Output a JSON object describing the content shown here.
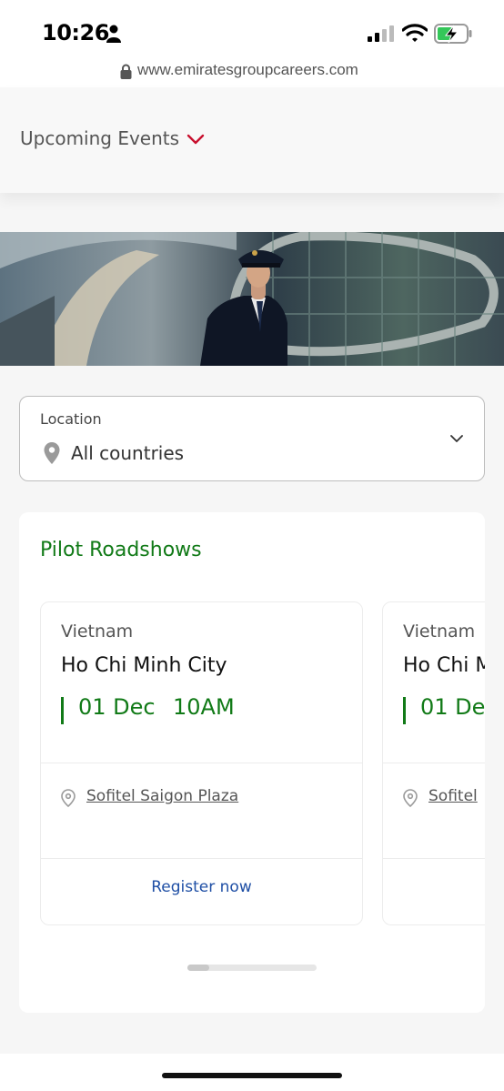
{
  "status_bar": {
    "time": "10:26"
  },
  "browser": {
    "url": "www.emiratesgroupcareers.com"
  },
  "events_menu": {
    "label": "Upcoming Events"
  },
  "location_filter": {
    "label": "Location",
    "value": "All countries"
  },
  "section": {
    "title": "Pilot Roadshows",
    "cards": [
      {
        "country": "Vietnam",
        "city": "Ho Chi Minh City",
        "date": "01 Dec",
        "time": "10AM",
        "venue": "Sofitel Saigon Plaza",
        "action": "Register now"
      },
      {
        "country": "Vietnam",
        "city": "Ho Chi M",
        "date": "01 De",
        "venue": "Sofitel"
      }
    ]
  },
  "colors": {
    "accent_green": "#117a17",
    "accent_red": "#c8102e",
    "link_blue": "#1f4fa5"
  }
}
